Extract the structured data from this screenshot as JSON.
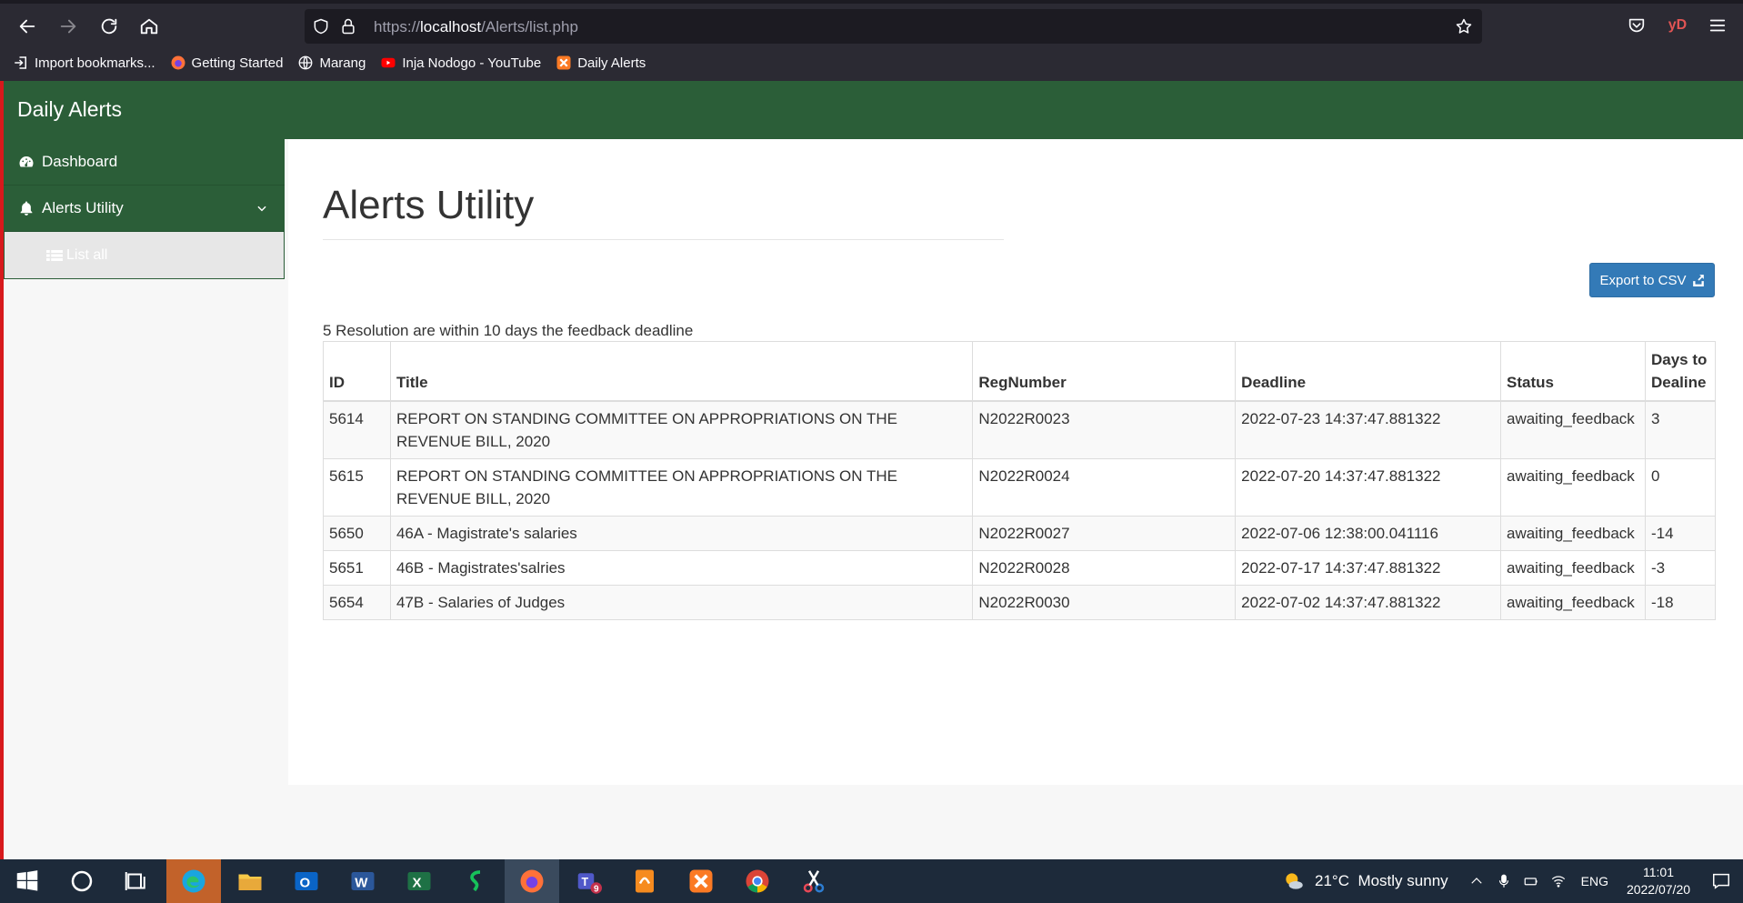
{
  "browser": {
    "url_prefix": "https://",
    "url_host": "localhost",
    "url_path": "/Alerts/list.php",
    "profile_initials": "yD",
    "bookmarks": [
      {
        "label": "Import bookmarks...",
        "icon": "import-icon"
      },
      {
        "label": "Getting Started",
        "icon": "firefox-icon"
      },
      {
        "label": "Marang",
        "icon": "globe-icon"
      },
      {
        "label": "Inja Nodogo - YouTube",
        "icon": "youtube-icon"
      },
      {
        "label": "Daily Alerts",
        "icon": "xampp-icon"
      }
    ]
  },
  "app": {
    "brand": "Daily Alerts",
    "header_color": "#2b5e38"
  },
  "sidebar": {
    "items": [
      {
        "label": "Dashboard",
        "icon": "dashboard-icon"
      },
      {
        "label": "Alerts Utility",
        "icon": "bell-icon"
      }
    ],
    "sub_items": [
      {
        "label": "List all",
        "icon": "list-icon"
      }
    ]
  },
  "main": {
    "title": "Alerts Utility",
    "export_label": "Export to CSV",
    "summary": "5 Resolution are within 10 days the feedback deadline",
    "columns": [
      "ID",
      "Title",
      "RegNumber",
      "Deadline",
      "Status",
      "Days to Dealine"
    ],
    "rows": [
      [
        "5614",
        "REPORT ON STANDING COMMITTEE ON APPROPRIATIONS ON THE REVENUE BILL, 2020",
        "N2022R0023",
        "2022-07-23 14:37:47.881322",
        "awaiting_feedback",
        "3"
      ],
      [
        "5615",
        "REPORT ON STANDING COMMITTEE ON APPROPRIATIONS ON THE REVENUE BILL, 2020",
        "N2022R0024",
        "2022-07-20 14:37:47.881322",
        "awaiting_feedback",
        "0"
      ],
      [
        "5650",
        "46A - Magistrate's salaries",
        "N2022R0027",
        "2022-07-06 12:38:00.041116",
        "awaiting_feedback",
        "-14"
      ],
      [
        "5651",
        "46B - Magistrates'salries",
        "N2022R0028",
        "2022-07-17 14:37:47.881322",
        "awaiting_feedback",
        "-3"
      ],
      [
        "5654",
        "47B - Salaries of Judges",
        "N2022R0030",
        "2022-07-02 14:37:47.881322",
        "awaiting_feedback",
        "-18"
      ]
    ]
  },
  "taskbar": {
    "weather": "21°C  Mostly sunny",
    "language": "ENG",
    "time": "11:01",
    "date": "2022/07/20",
    "teams_badge": "9"
  }
}
